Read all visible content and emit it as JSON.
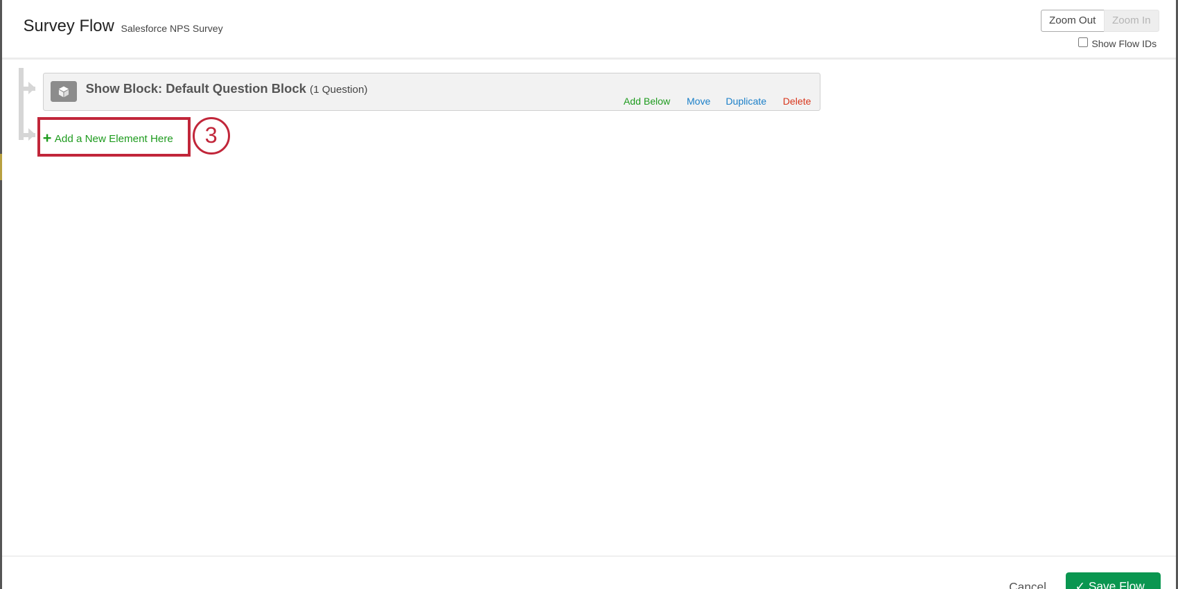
{
  "header": {
    "title": "Survey Flow",
    "subtitle": "Salesforce NPS Survey",
    "zoom_out": "Zoom Out",
    "zoom_in": "Zoom In",
    "show_flow_ids": "Show Flow IDs"
  },
  "block": {
    "title": "Show Block: Default Question Block",
    "count": "(1 Question)",
    "actions": {
      "add_below": "Add Below",
      "move": "Move",
      "duplicate": "Duplicate",
      "delete": "Delete"
    }
  },
  "add_element": {
    "plus": "+",
    "label": "Add a New Element Here"
  },
  "annotation": {
    "step": "3"
  },
  "footer": {
    "cancel": "Cancel",
    "save": "Save Flow",
    "check": "✓"
  },
  "colors": {
    "green": "#1e9b1e",
    "blue": "#1a7fc8",
    "red": "#d8351b",
    "highlight": "#c1263a",
    "save": "#0a9650"
  }
}
